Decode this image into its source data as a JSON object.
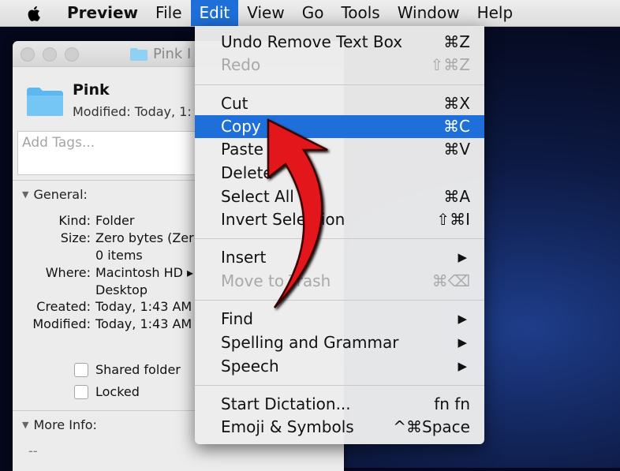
{
  "menubar": {
    "app": "Preview",
    "items": [
      "File",
      "Edit",
      "View",
      "Go",
      "Tools",
      "Window",
      "Help"
    ]
  },
  "info_window": {
    "title": "Pink I",
    "name": "Pink",
    "modified_header": "Modified: Today, 1:",
    "tags_placeholder": "Add Tags...",
    "general_label": "General:",
    "kind_key": "Kind:",
    "kind_val": "Folder",
    "size_key": "Size:",
    "size_val": "Zero bytes (Zer",
    "items_val": "0 items",
    "where_key": "Where:",
    "where_val": "Macintosh HD ▸",
    "where_val2": "Desktop",
    "created_key": "Created:",
    "created_val": "Today, 1:43 AM",
    "modified_key": "Modified:",
    "modified_val": "Today, 1:43 AM",
    "shared_label": "Shared folder",
    "locked_label": "Locked",
    "moreinfo_label": "More Info:",
    "moreinfo_val": "--"
  },
  "edit_menu": {
    "undo": {
      "label": "Undo Remove Text Box",
      "shortcut": "⌘Z"
    },
    "redo": {
      "label": "Redo",
      "shortcut": "⇧⌘Z"
    },
    "cut": {
      "label": "Cut",
      "shortcut": "⌘X"
    },
    "copy": {
      "label": "Copy",
      "shortcut": "⌘C"
    },
    "paste": {
      "label": "Paste",
      "shortcut": "⌘V"
    },
    "delete": {
      "label": "Delete"
    },
    "select_all": {
      "label": "Select All",
      "shortcut": "⌘A"
    },
    "invert": {
      "label": "Invert Selection",
      "shortcut": "⇧⌘I"
    },
    "insert": {
      "label": "Insert",
      "arrow": "▶"
    },
    "move_trash": {
      "label": "Move to Trash",
      "shortcut": "⌘⌫"
    },
    "find": {
      "label": "Find",
      "arrow": "▶"
    },
    "spelling": {
      "label": "Spelling and Grammar",
      "arrow": "▶"
    },
    "speech": {
      "label": "Speech",
      "arrow": "▶"
    },
    "dictation": {
      "label": "Start Dictation...",
      "shortcut": "fn fn"
    },
    "emoji": {
      "label": "Emoji & Symbols",
      "shortcut": "^⌘Space"
    }
  },
  "colors": {
    "selection": "#1e6fd9",
    "arrow": "#e3121b",
    "folder": "#5cb8f0"
  },
  "icons": [
    "apple-icon",
    "folder-icon",
    "annotation-arrow"
  ]
}
